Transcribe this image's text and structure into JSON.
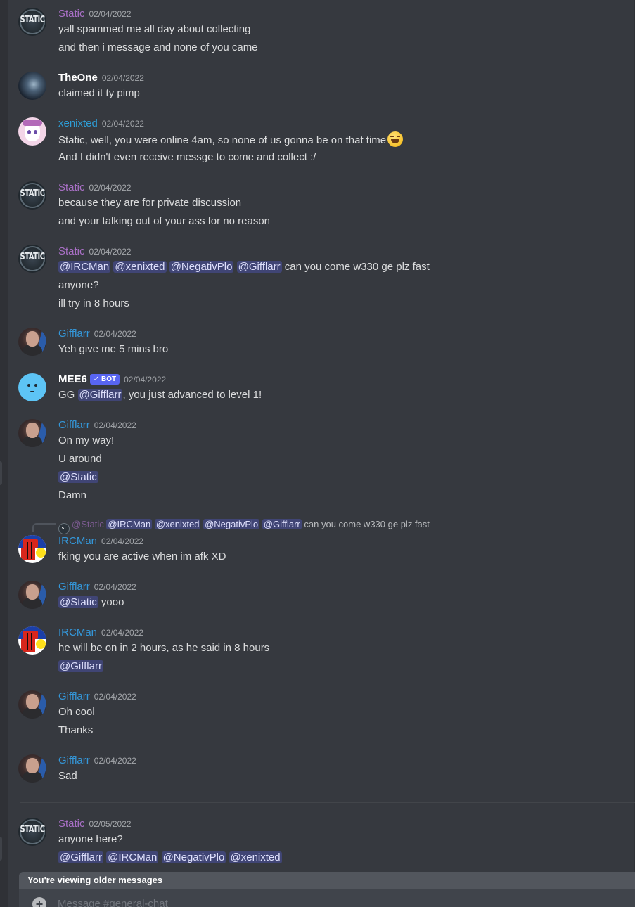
{
  "channel": {
    "placeholder": "Message #general-chat",
    "older_messages_notice": "You're viewing older messages"
  },
  "colors": {
    "background": "#36393f",
    "static_name": "#a970c6",
    "link_name": "#3498db",
    "mention_bg": "rgba(88,101,242,0.3)",
    "bot_tag": "#5865f2"
  },
  "messages": [
    {
      "author": "Static",
      "timestamp": "02/04/2022",
      "lines": [
        "yall spammed me all day about collecting",
        "and then i message and none of you came"
      ]
    },
    {
      "author": "TheOne",
      "timestamp": "02/04/2022",
      "lines": [
        "claimed it ty pimp"
      ]
    },
    {
      "author": "xenixted",
      "timestamp": "02/04/2022",
      "lines": [
        "Static, well, you were online 4am, so none of us gonna be on that time",
        "And I didn't even receive messge to come and collect :/"
      ],
      "emoji": "smile-emoji"
    },
    {
      "author": "Static",
      "timestamp": "02/04/2022",
      "lines": [
        "because they are for private discussion",
        "and your talking out of your ass for no reason"
      ]
    },
    {
      "author": "Static",
      "timestamp": "02/04/2022",
      "mentions": [
        "@IRCMan",
        "@xenixted",
        "@NegativPlo",
        "@Gifflarr"
      ],
      "lines": [
        "can you come w330 ge plz fast",
        "anyone?",
        "ill try in 8 hours"
      ]
    },
    {
      "author": "Gifflarr",
      "timestamp": "02/04/2022",
      "lines": [
        "Yeh give me 5 mins bro"
      ]
    },
    {
      "author": "MEE6",
      "bot_tag": "✓ BOT",
      "timestamp": "02/04/2022",
      "prefix": "GG",
      "mention": "@Gifflarr",
      "suffix": ", you just advanced to level 1!"
    },
    {
      "author": "Gifflarr",
      "timestamp": "02/04/2022",
      "lines": [
        "On my way!",
        "U around",
        "Damn"
      ],
      "mention": "@Static"
    },
    {
      "author": "IRCMan",
      "timestamp": "02/04/2022",
      "reply": {
        "author": "@Static",
        "mentions": [
          "@IRCMan",
          "@xenixted",
          "@NegativPlo",
          "@Gifflarr"
        ],
        "text": "can you come w330 ge plz fast"
      },
      "lines": [
        "fking you are active when im afk XD"
      ]
    },
    {
      "author": "Gifflarr",
      "timestamp": "02/04/2022",
      "mention": "@Static",
      "text": "yooo"
    },
    {
      "author": "IRCMan",
      "timestamp": "02/04/2022",
      "lines": [
        "he will be on in 2 hours, as he said in 8 hours"
      ],
      "mention": "@Gifflarr"
    },
    {
      "author": "Gifflarr",
      "timestamp": "02/04/2022",
      "lines": [
        "Oh cool",
        "Thanks"
      ]
    },
    {
      "author": "Gifflarr",
      "timestamp": "02/04/2022",
      "lines": [
        "Sad"
      ]
    },
    {
      "author": "Static",
      "timestamp": "02/05/2022",
      "lines": [
        "anyone here?"
      ],
      "mentions": [
        "@Gifflarr",
        "@IRCMan",
        "@NegativPlo",
        "@xenixted"
      ]
    }
  ]
}
